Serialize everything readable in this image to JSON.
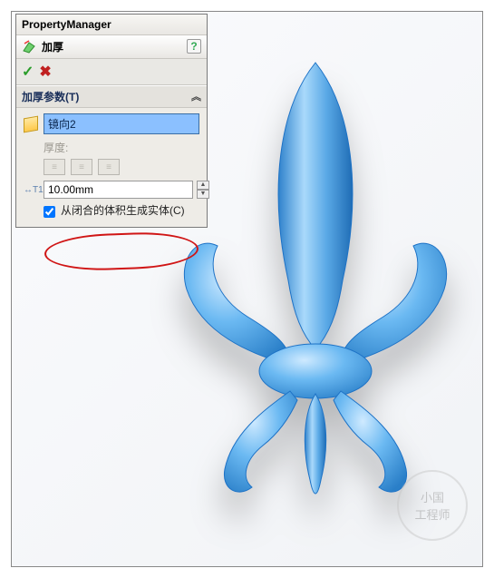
{
  "panel": {
    "title": "PropertyManager",
    "feature_icon": "thicken-icon",
    "feature_label": "加厚",
    "help_label": "?",
    "ok_glyph": "✓",
    "cancel_glyph": "✖"
  },
  "section": {
    "header": "加厚参数(T)",
    "selection": "镜向2",
    "thickness_label": "厚度:",
    "dim_icon": "↔T1",
    "dim_value": "10.00mm",
    "checkbox_checked": true,
    "checkbox_label": "从闭合的体积生成实体(C)"
  },
  "watermark": {
    "line1": "小国",
    "line2": "工程师"
  },
  "colors": {
    "model_main": "#5fb2ee",
    "model_edge": "#1d72c6",
    "selection_bg": "#8bc0ff",
    "annotation": "#d01515"
  }
}
